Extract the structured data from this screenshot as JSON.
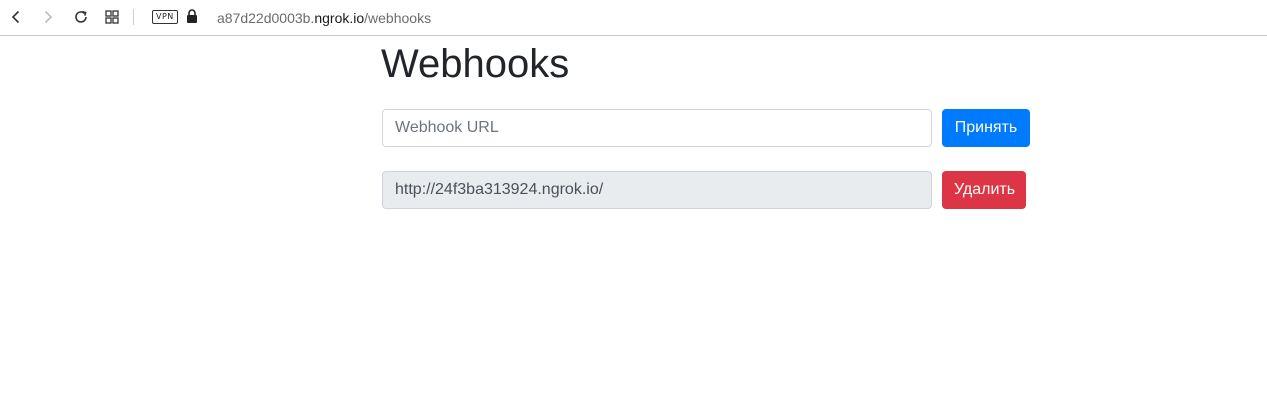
{
  "browser": {
    "vpn_label": "VPN",
    "url_prefix": "a87d22d0003b.",
    "url_host": "ngrok.io",
    "url_path": "/webhooks",
    "icons": {
      "back": "back-arrow-icon",
      "forward": "forward-arrow-icon",
      "reload": "reload-icon",
      "tabs": "tab-grid-icon",
      "lock": "lock-icon"
    }
  },
  "page": {
    "title": "Webhooks",
    "url_input": {
      "placeholder": "Webhook URL",
      "value": ""
    },
    "accept_button": "Принять",
    "webhooks": [
      {
        "url": "http://24f3ba313924.ngrok.io/",
        "delete_button": "Удалить"
      }
    ]
  },
  "colors": {
    "primary": "#007bff",
    "danger": "#dc3545",
    "readonly_bg": "#e9ecef",
    "text": "#212529"
  }
}
